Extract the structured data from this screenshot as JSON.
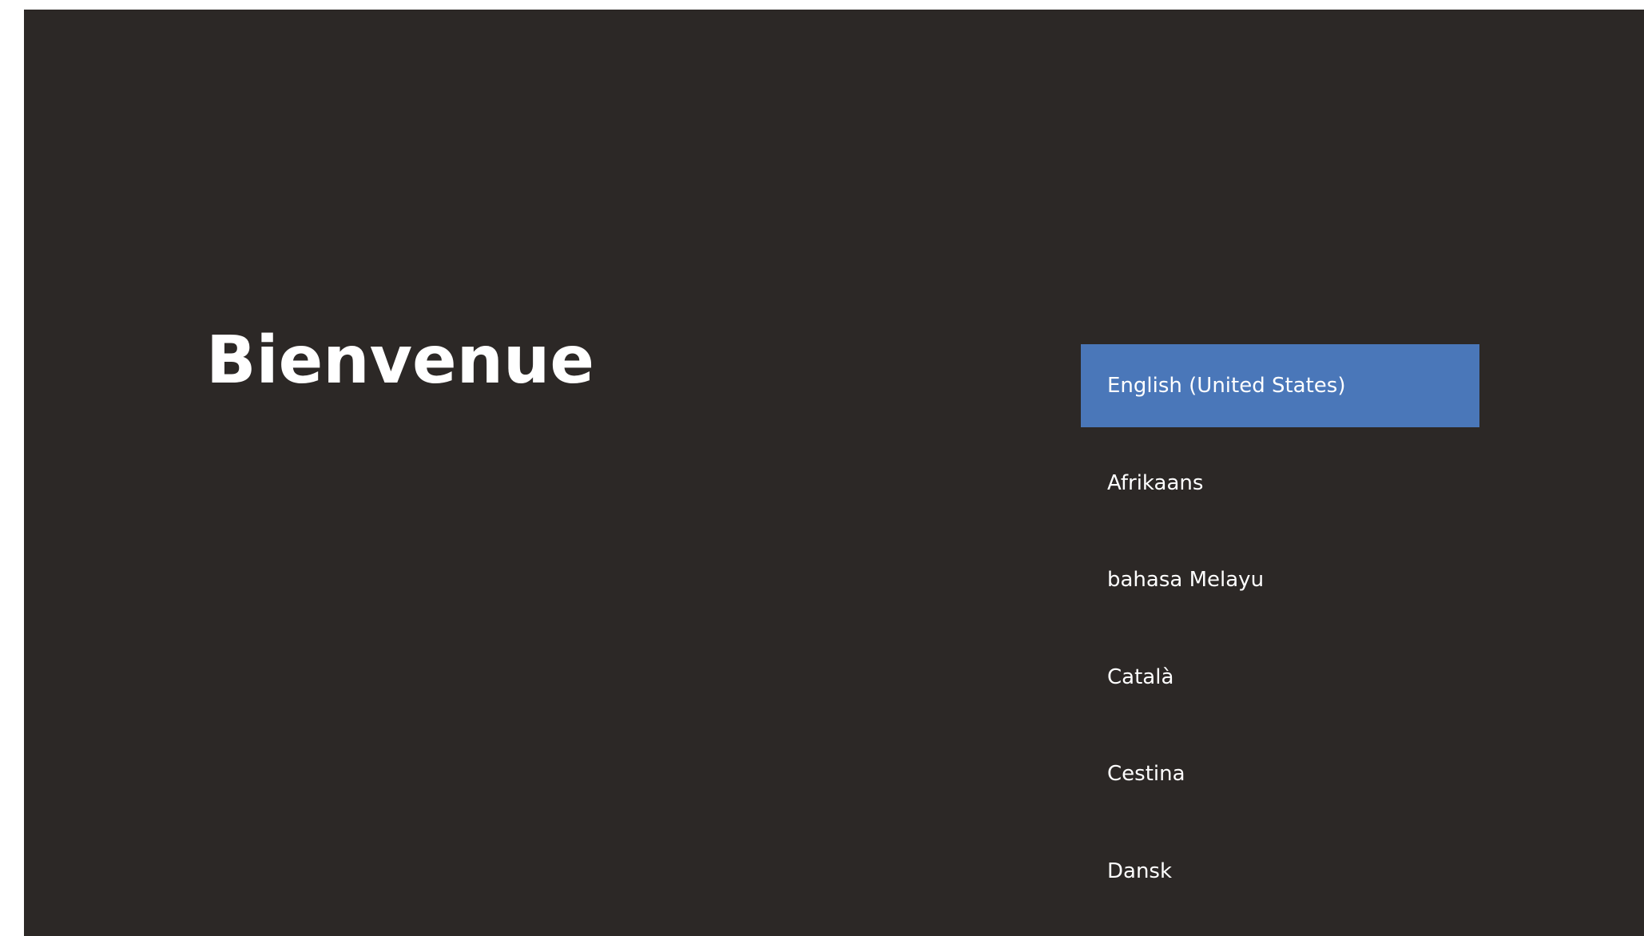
{
  "welcome": {
    "title": "Bienvenue"
  },
  "languages": {
    "selected_index": 0,
    "items": [
      {
        "label": "English (United States)"
      },
      {
        "label": "Afrikaans"
      },
      {
        "label": "bahasa Melayu"
      },
      {
        "label": "Català"
      },
      {
        "label": "Cestina"
      },
      {
        "label": "Dansk"
      }
    ]
  },
  "colors": {
    "background": "#2c2826",
    "selected_highlight": "#4a77b9",
    "text": "#ffffff"
  }
}
